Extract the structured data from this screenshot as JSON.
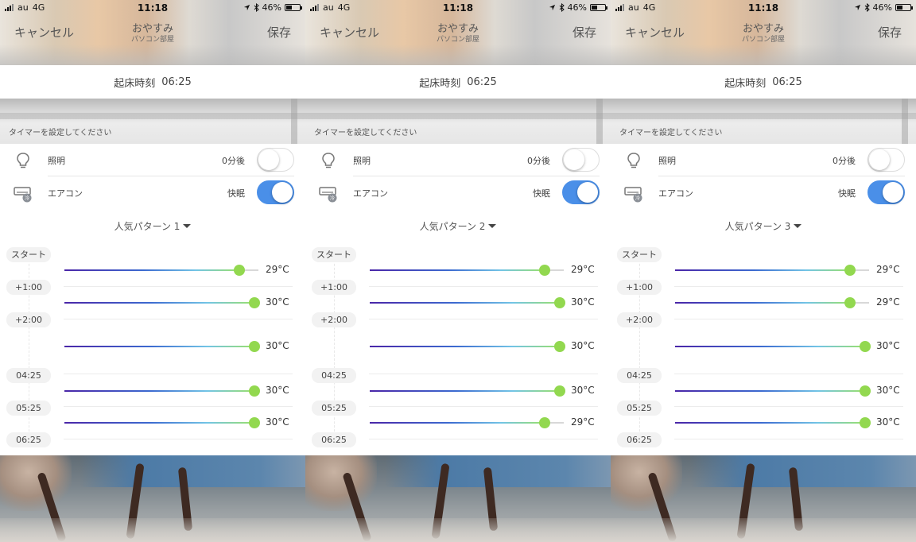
{
  "status_bar": {
    "carrier": "au",
    "network": "4G",
    "time": "11:18",
    "battery": "46%",
    "battery_fraction": 0.46
  },
  "nav": {
    "cancel": "キャンセル",
    "title": "おやすみ",
    "subtitle": "パソコン部屋",
    "save": "保存"
  },
  "wake": {
    "label": "起床時刻",
    "time": "06:25"
  },
  "timer_hint": "タイマーを設定してください",
  "colors": {
    "toggle_on": "#4a8fe8",
    "thumb": "#92d84f",
    "gradient_start": "#4a26a8"
  },
  "screens": [
    {
      "lighting": {
        "icon": "lightbulb-icon",
        "label": "照明",
        "value": "0分後",
        "on": false
      },
      "aircon": {
        "icon": "aircon-icon",
        "label": "エアコン",
        "value": "快眠",
        "on": true
      },
      "pattern": "人気パターン 1",
      "time_labels": [
        "スタート",
        "+1:00",
        "+2:00",
        "04:25",
        "05:25",
        "06:25"
      ],
      "temps": [
        {
          "label": "29°C",
          "value": 29,
          "level": 0.9
        },
        {
          "label": "30°C",
          "value": 30,
          "level": 0.98
        },
        {
          "label": "30°C",
          "value": 30,
          "level": 0.98
        },
        {
          "label": "30°C",
          "value": 30,
          "level": 0.98
        },
        {
          "label": "30°C",
          "value": 30,
          "level": 0.98
        }
      ]
    },
    {
      "lighting": {
        "icon": "lightbulb-icon",
        "label": "照明",
        "value": "0分後",
        "on": false
      },
      "aircon": {
        "icon": "aircon-icon",
        "label": "エアコン",
        "value": "快眠",
        "on": true
      },
      "pattern": "人気パターン 2",
      "time_labels": [
        "スタート",
        "+1:00",
        "+2:00",
        "04:25",
        "05:25",
        "06:25"
      ],
      "temps": [
        {
          "label": "29°C",
          "value": 29,
          "level": 0.9
        },
        {
          "label": "30°C",
          "value": 30,
          "level": 0.98
        },
        {
          "label": "30°C",
          "value": 30,
          "level": 0.98
        },
        {
          "label": "30°C",
          "value": 30,
          "level": 0.98
        },
        {
          "label": "29°C",
          "value": 29,
          "level": 0.9
        }
      ]
    },
    {
      "lighting": {
        "icon": "lightbulb-icon",
        "label": "照明",
        "value": "0分後",
        "on": false
      },
      "aircon": {
        "icon": "aircon-icon",
        "label": "エアコン",
        "value": "快眠",
        "on": true
      },
      "pattern": "人気パターン 3",
      "time_labels": [
        "スタート",
        "+1:00",
        "+2:00",
        "04:25",
        "05:25",
        "06:25"
      ],
      "temps": [
        {
          "label": "29°C",
          "value": 29,
          "level": 0.9
        },
        {
          "label": "29°C",
          "value": 29,
          "level": 0.9
        },
        {
          "label": "30°C",
          "value": 30,
          "level": 0.98
        },
        {
          "label": "30°C",
          "value": 30,
          "level": 0.98
        },
        {
          "label": "30°C",
          "value": 30,
          "level": 0.98
        }
      ]
    }
  ]
}
